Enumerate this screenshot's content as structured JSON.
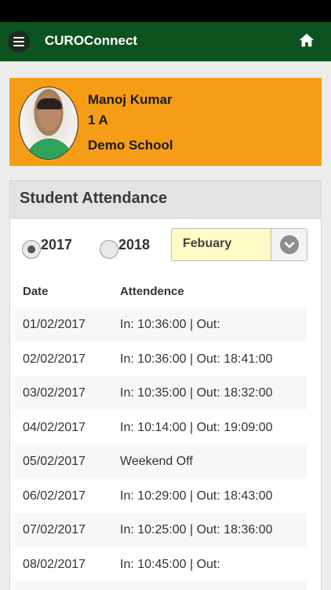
{
  "app": {
    "title": "CUROConnect"
  },
  "icons": {
    "menu": "hamburger-menu-icon",
    "home": "home-icon",
    "dropdown": "chevron-down-icon"
  },
  "colors": {
    "appbar": "#0d531f",
    "profile_card": "#f59d16",
    "select_bg": "#fffac6"
  },
  "profile": {
    "name": "Manoj Kumar",
    "class": "1 A",
    "school": "Demo School"
  },
  "attendance": {
    "title": "Student Attendance",
    "years": [
      {
        "label": "2017",
        "selected": true
      },
      {
        "label": "2018",
        "selected": false
      }
    ],
    "month": "Febuary",
    "columns": {
      "date": "Date",
      "attendance": "Attendence"
    },
    "rows": [
      {
        "date": "01/02/2017",
        "value": "In: 10:36:00 | Out:"
      },
      {
        "date": "02/02/2017",
        "value": "In: 10:36:00 | Out: 18:41:00"
      },
      {
        "date": "03/02/2017",
        "value": "In: 10:35:00 | Out: 18:32:00"
      },
      {
        "date": "04/02/2017",
        "value": "In: 10:14:00 | Out: 19:09:00"
      },
      {
        "date": "05/02/2017",
        "value": "Weekend Off"
      },
      {
        "date": "06/02/2017",
        "value": "In: 10:29:00 | Out: 18:43:00"
      },
      {
        "date": "07/02/2017",
        "value": "In: 10:25:00 | Out: 18:36:00"
      },
      {
        "date": "08/02/2017",
        "value": "In: 10:45:00 | Out:"
      }
    ]
  }
}
